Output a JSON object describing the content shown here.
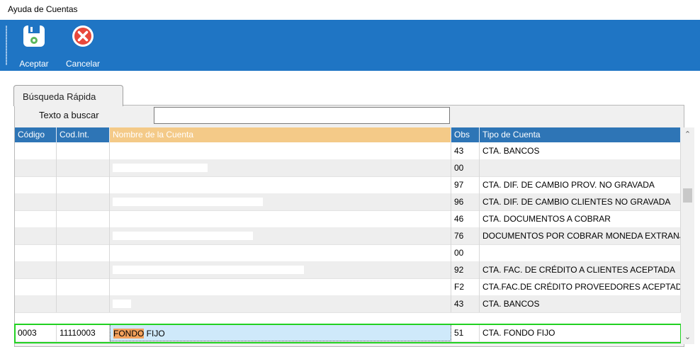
{
  "window": {
    "title": "Ayuda de Cuentas"
  },
  "toolbar": {
    "accept_label": "Aceptar",
    "cancel_label": "Cancelar",
    "accept_icon": "save-icon",
    "cancel_icon": "cancel-icon",
    "background": "#1f75c4"
  },
  "tab": {
    "label": "Búsqueda Rápida"
  },
  "search": {
    "label": "Texto a buscar",
    "value": ""
  },
  "grid": {
    "columns": [
      "Código",
      "Cod.Int.",
      "Nombre de la Cuenta",
      "Obs",
      "Tipo de Cuenta"
    ],
    "sorted_column": "Nombre de la Cuenta",
    "rows": [
      {
        "obs": "43",
        "tipo": "CTA. BANCOS"
      },
      {
        "obs": "00",
        "tipo": ""
      },
      {
        "obs": "97",
        "tipo": "CTA. DIF. DE CAMBIO PROV. NO GRAVADA"
      },
      {
        "obs": "96",
        "tipo": "CTA. DIF. DE CAMBIO CLIENTES NO GRAVADA"
      },
      {
        "obs": "46",
        "tipo": "CTA. DOCUMENTOS A COBRAR"
      },
      {
        "obs": "76",
        "tipo": "DOCUMENTOS POR COBRAR MONEDA EXTRANJ"
      },
      {
        "obs": "00",
        "tipo": ""
      },
      {
        "obs": "92",
        "tipo": "CTA. FAC. DE CRÉDITO A CLIENTES ACEPTADA"
      },
      {
        "obs": "F2",
        "tipo": "CTA.FAC.DE CRÉDITO PROVEEDORES ACEPTAD"
      },
      {
        "obs": "43",
        "tipo": "CTA. BANCOS"
      }
    ],
    "selected_row": {
      "codigo": "0003",
      "cod_int": "11110003",
      "nombre_match": "FONDO",
      "nombre_rest": " FIJO",
      "obs": "51",
      "tipo": "CTA. FONDO FIJO"
    }
  }
}
